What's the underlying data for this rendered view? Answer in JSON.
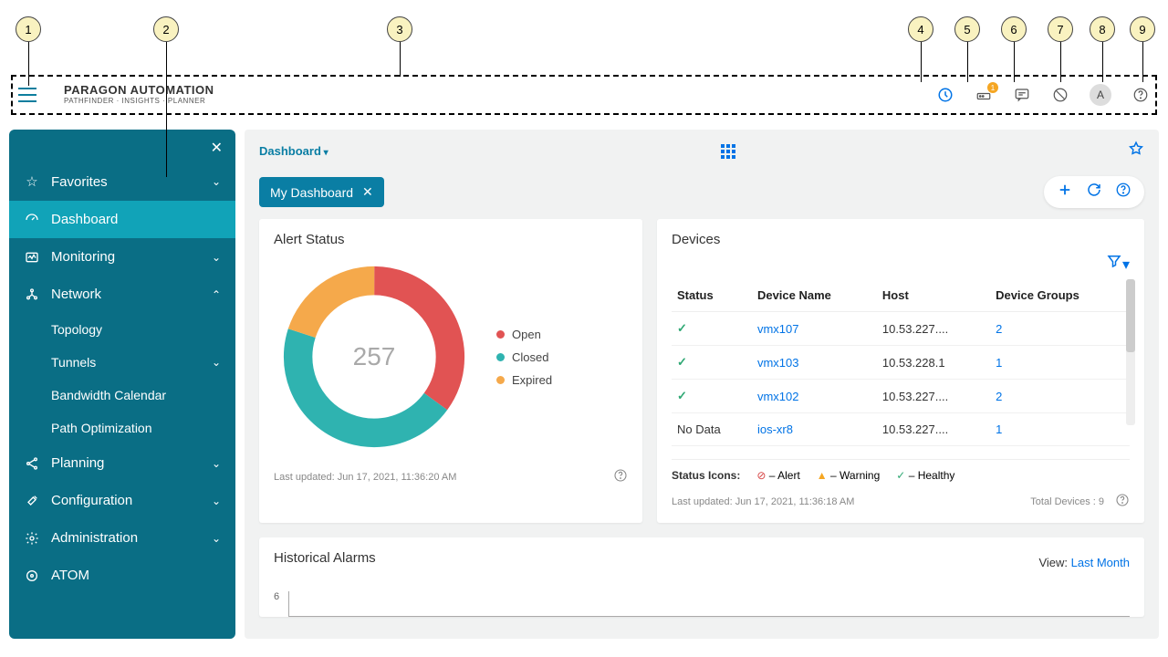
{
  "callouts": [
    "1",
    "2",
    "3",
    "4",
    "5",
    "6",
    "7",
    "8",
    "9"
  ],
  "banner": {
    "brand": "PARAGON AUTOMATION",
    "sub": "PATHFINDER · INSIGHTS · PLANNER",
    "badge": "1",
    "avatar": "A"
  },
  "sidebar": {
    "favorites": "Favorites",
    "dashboard": "Dashboard",
    "monitoring": "Monitoring",
    "network": "Network",
    "network_children": {
      "topology": "Topology",
      "tunnels": "Tunnels",
      "bw_cal": "Bandwidth Calendar",
      "path_opt": "Path Optimization"
    },
    "planning": "Planning",
    "configuration": "Configuration",
    "administration": "Administration",
    "atom": "ATOM"
  },
  "breadcrumb": "Dashboard",
  "tab": {
    "label": "My Dashboard"
  },
  "alert_card": {
    "title": "Alert Status",
    "total": "257",
    "legend": {
      "open": "Open",
      "closed": "Closed",
      "expired": "Expired"
    },
    "colors": {
      "open": "#e15353",
      "closed": "#2fb3b0",
      "expired": "#f5a94b"
    },
    "footer": "Last updated: Jun 17, 2021, 11:36:20 AM"
  },
  "devices_card": {
    "title": "Devices",
    "columns": {
      "status": "Status",
      "name": "Device Name",
      "host": "Host",
      "groups": "Device Groups"
    },
    "rows": [
      {
        "status": "healthy",
        "name": "vmx107",
        "host": "10.53.227....",
        "groups": "2"
      },
      {
        "status": "healthy",
        "name": "vmx103",
        "host": "10.53.228.1",
        "groups": "1"
      },
      {
        "status": "healthy",
        "name": "vmx102",
        "host": "10.53.227....",
        "groups": "2"
      },
      {
        "status": "nodata",
        "name": "ios-xr8",
        "host": "10.53.227....",
        "groups": "1"
      }
    ],
    "nodata_label": "No Data",
    "legend": {
      "title": "Status Icons:",
      "alert": "– Alert",
      "warning": "– Warning",
      "healthy": "– Healthy"
    },
    "footer_left": "Last updated: Jun 17, 2021, 11:36:18 AM",
    "footer_right": "Total Devices : 9"
  },
  "hist_card": {
    "title": "Historical Alarms",
    "view_label": "View:",
    "view_value": "Last Month",
    "ytick": "6"
  },
  "chart_data": {
    "type": "pie",
    "title": "Alert Status",
    "total": 257,
    "series": [
      {
        "name": "Open",
        "value": 90,
        "color": "#e15353"
      },
      {
        "name": "Closed",
        "value": 115,
        "color": "#2fb3b0"
      },
      {
        "name": "Expired",
        "value": 52,
        "color": "#f5a94b"
      }
    ]
  }
}
